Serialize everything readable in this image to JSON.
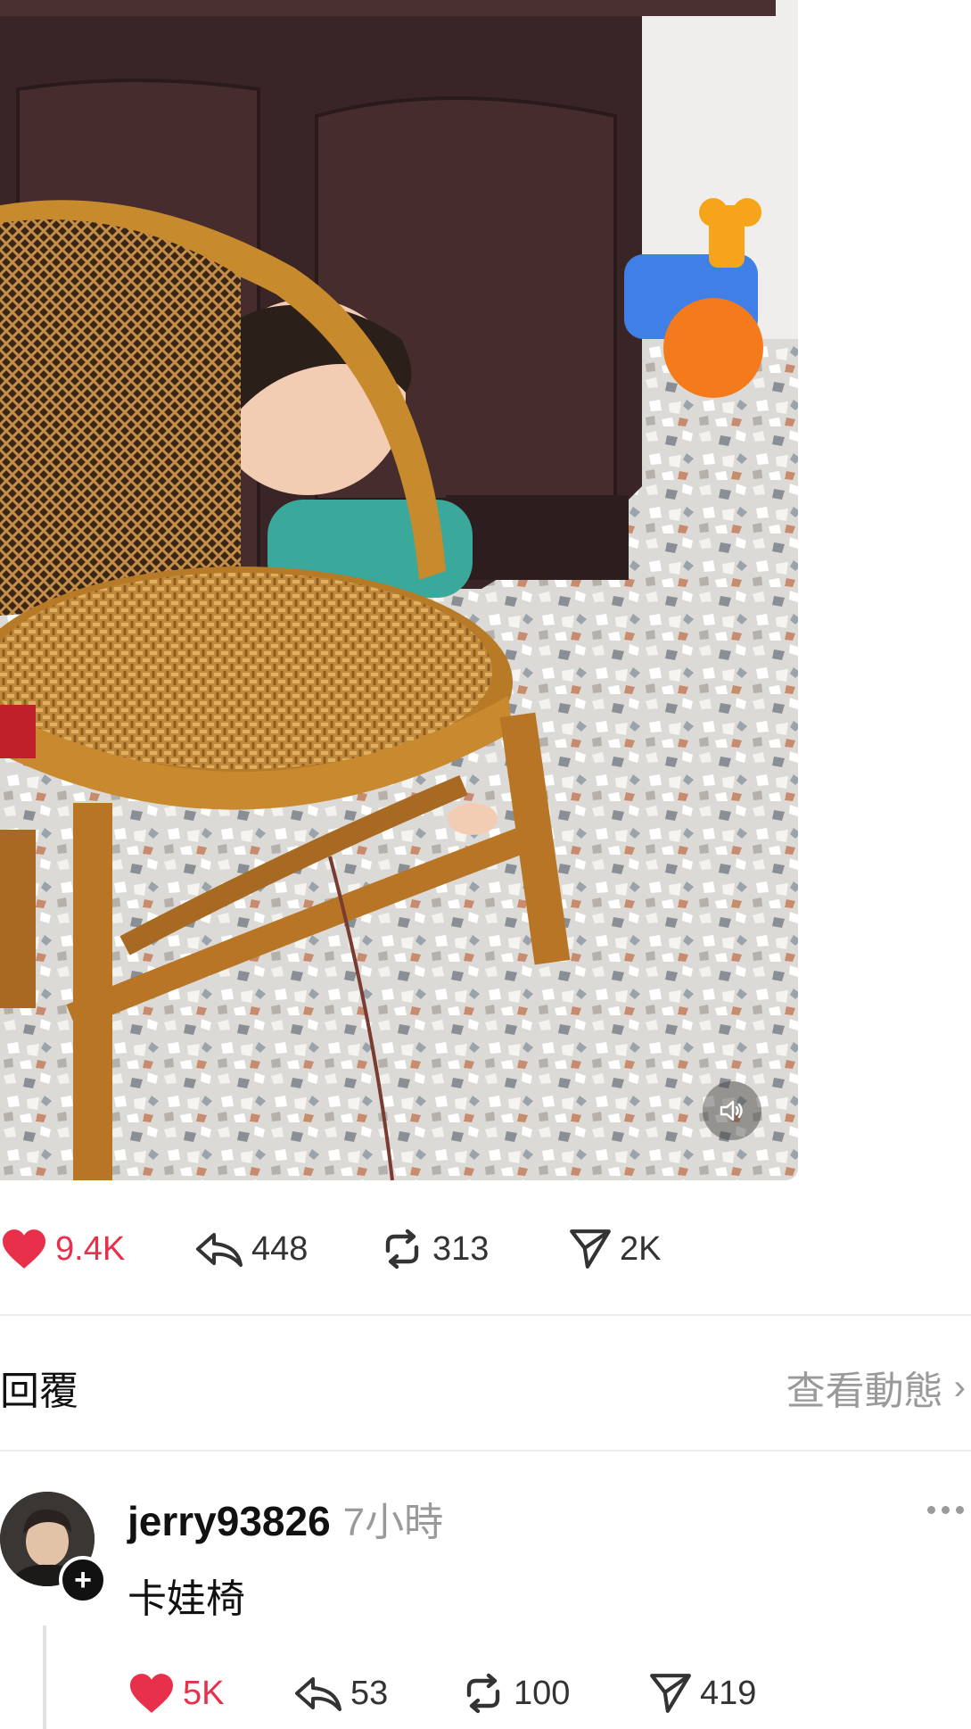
{
  "post": {
    "likes": "9.4K",
    "replies": "448",
    "reposts": "313",
    "shares": "2K"
  },
  "replies_section": {
    "title": "回覆",
    "view_activity": "查看動態",
    "chevron": "›"
  },
  "comment": {
    "username": "jerry93826",
    "time": "7小時",
    "text": "卡娃椅",
    "likes": "5K",
    "replies": "53",
    "reposts": "100",
    "shares": "419"
  },
  "icons": {
    "like": "heart-icon",
    "reply": "reply-arrow-icon",
    "repost": "repost-icon",
    "share": "send-icon",
    "sound": "speaker-icon",
    "more": "more-dots-icon"
  },
  "colors": {
    "like_red": "#e8304a",
    "muted_gray": "#9a9a9a"
  }
}
